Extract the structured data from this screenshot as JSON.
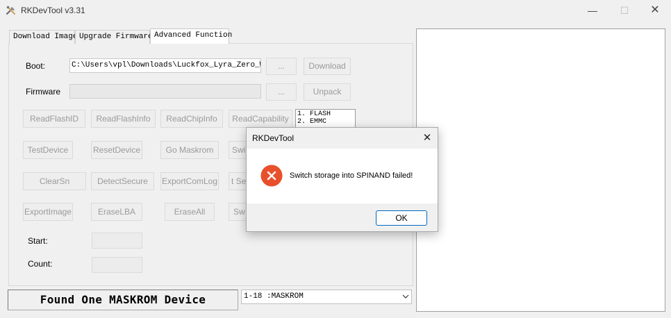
{
  "window": {
    "title": "RKDevTool v3.31",
    "minimize": "—",
    "maximize": "☐",
    "close": "✕"
  },
  "tabs": [
    {
      "label": "Download Image"
    },
    {
      "label": "Upgrade Firmware"
    },
    {
      "label": "Advanced Function",
      "active": true
    }
  ],
  "boot": {
    "label": "Boot:",
    "path": "C:\\Users\\vpl\\Downloads\\Luckfox_Lyra_Zero_W_Fl",
    "browse": "...",
    "action": "Download"
  },
  "firmware": {
    "label": "Firmware",
    "path": "",
    "browse": "...",
    "action": "Unpack"
  },
  "buttons": {
    "row1": [
      "ReadFlashID",
      "ReadFlashInfo",
      "ReadChipInfo",
      "ReadCapability"
    ],
    "row2": [
      "TestDevice",
      "ResetDevice",
      "Go Maskrom",
      "Swi"
    ],
    "row3": [
      "ClearSn",
      "DetectSecure",
      "ExportComLog",
      "t Se"
    ],
    "row4": [
      "ExportImage",
      "EraseLBA",
      "EraseAll",
      "Sw"
    ]
  },
  "storage_list": [
    "1. FLASH",
    "2. EMMC"
  ],
  "start": {
    "label": "Start:",
    "value": ""
  },
  "count": {
    "label": "Count:",
    "value": ""
  },
  "status": {
    "text": "Found One MASKROM Device"
  },
  "device_select": {
    "value": "1-18 :MASKROM"
  },
  "dialog": {
    "title": "RKDevTool",
    "close": "✕",
    "message": "Switch storage into SPINAND failed!",
    "ok": "OK",
    "icon": "error-icon"
  },
  "colors": {
    "error_red": "#e8502c",
    "accent_blue": "#0067c0",
    "disabled_text": "#9a9a9a"
  }
}
